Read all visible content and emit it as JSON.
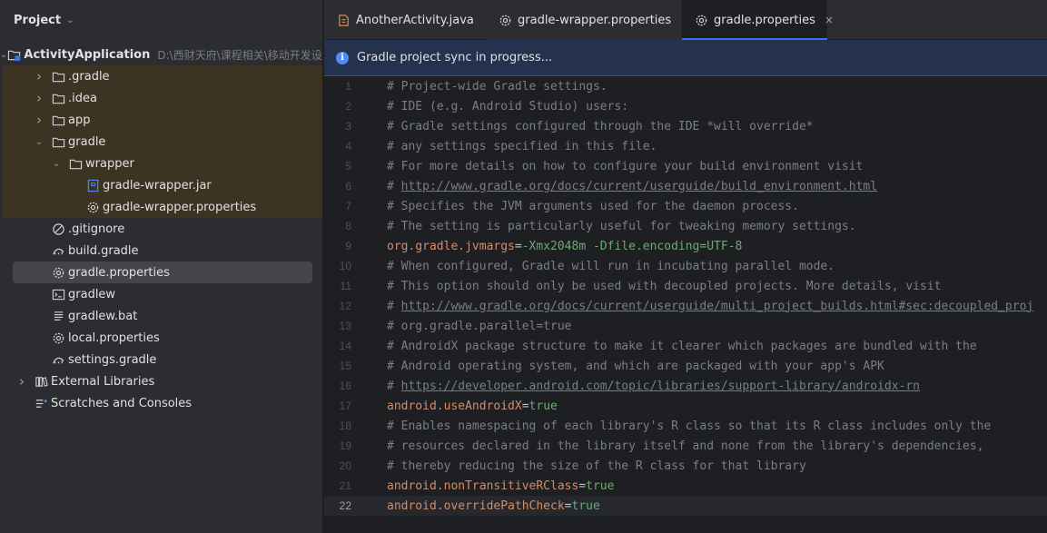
{
  "project_panel": {
    "title": "Project",
    "tree": [
      {
        "label": "ActivityApplication",
        "path": "D:\\西财天府\\课程相关\\移动开发设计",
        "icon": "module-folder-icon",
        "arrow": "down",
        "depth": 0,
        "bold": true
      },
      {
        "label": ".gradle",
        "icon": "folder-icon",
        "arrow": "right",
        "depth": 1,
        "highlight": true
      },
      {
        "label": ".idea",
        "icon": "folder-icon",
        "arrow": "right",
        "depth": 1,
        "highlight": true
      },
      {
        "label": "app",
        "icon": "folder-icon",
        "arrow": "right",
        "depth": 1,
        "highlight": true
      },
      {
        "label": "gradle",
        "icon": "folder-icon",
        "arrow": "down",
        "depth": 1,
        "highlight": true
      },
      {
        "label": "wrapper",
        "icon": "folder-icon",
        "arrow": "down",
        "depth": 2,
        "highlight": true
      },
      {
        "label": "gradle-wrapper.jar",
        "icon": "jar-file-icon",
        "arrow": "",
        "depth": 3,
        "highlight": true
      },
      {
        "label": "gradle-wrapper.properties",
        "icon": "properties-file-icon",
        "arrow": "",
        "depth": 3,
        "highlight": true
      },
      {
        "label": ".gitignore",
        "icon": "gitignore-file-icon",
        "arrow": "",
        "depth": 1
      },
      {
        "label": "build.gradle",
        "icon": "gradle-file-icon",
        "arrow": "",
        "depth": 1
      },
      {
        "label": "gradle.properties",
        "icon": "properties-file-icon",
        "arrow": "",
        "depth": 1,
        "selected": true
      },
      {
        "label": "gradlew",
        "icon": "terminal-file-icon",
        "arrow": "",
        "depth": 1
      },
      {
        "label": "gradlew.bat",
        "icon": "text-file-icon",
        "arrow": "",
        "depth": 1
      },
      {
        "label": "local.properties",
        "icon": "properties-file-icon",
        "arrow": "",
        "depth": 1
      },
      {
        "label": "settings.gradle",
        "icon": "gradle-file-icon",
        "arrow": "",
        "depth": 1
      },
      {
        "label": "External Libraries",
        "icon": "libraries-icon",
        "arrow": "right",
        "depth": 0
      },
      {
        "label": "Scratches and Consoles",
        "icon": "scratches-icon",
        "arrow": "",
        "depth": 0
      }
    ]
  },
  "tabs": [
    {
      "label": "AnotherActivity.java",
      "icon": "java-file-icon",
      "active": false,
      "closable": false
    },
    {
      "label": "gradle-wrapper.properties",
      "icon": "properties-file-icon",
      "active": false,
      "closable": false
    },
    {
      "label": "gradle.properties",
      "icon": "properties-file-icon",
      "active": true,
      "closable": true,
      "close_glyph": "×"
    }
  ],
  "banner": {
    "text": "Gradle project sync in progress...",
    "icon": "info-icon",
    "icon_glyph": "i"
  },
  "editor": {
    "current_line": 22,
    "lines": [
      {
        "n": 1,
        "type": "comment",
        "text": "# Project-wide Gradle settings."
      },
      {
        "n": 2,
        "type": "comment",
        "text": "# IDE (e.g. Android Studio) users:"
      },
      {
        "n": 3,
        "type": "comment",
        "text": "# Gradle settings configured through the IDE *will override*"
      },
      {
        "n": 4,
        "type": "comment",
        "text": "# any settings specified in this file."
      },
      {
        "n": 5,
        "type": "comment",
        "text": "# For more details on how to configure your build environment visit"
      },
      {
        "n": 6,
        "type": "url",
        "prefix": "# ",
        "text": "http://www.gradle.org/docs/current/userguide/build_environment.html"
      },
      {
        "n": 7,
        "type": "comment",
        "text": "# Specifies the JVM arguments used for the daemon process."
      },
      {
        "n": 8,
        "type": "comment",
        "text": "# The setting is particularly useful for tweaking memory settings."
      },
      {
        "n": 9,
        "type": "prop",
        "key": "org.gradle.jvmargs",
        "eq": "=",
        "value": "-Xmx2048m -Dfile.encoding=UTF-8"
      },
      {
        "n": 10,
        "type": "comment",
        "text": "# When configured, Gradle will run in incubating parallel mode."
      },
      {
        "n": 11,
        "type": "comment",
        "text": "# This option should only be used with decoupled projects. More details, visit"
      },
      {
        "n": 12,
        "type": "url",
        "prefix": "# ",
        "text": "http://www.gradle.org/docs/current/userguide/multi_project_builds.html#sec:decoupled_proj"
      },
      {
        "n": 13,
        "type": "comment",
        "text": "# org.gradle.parallel=true"
      },
      {
        "n": 14,
        "type": "comment",
        "text": "# AndroidX package structure to make it clearer which packages are bundled with the"
      },
      {
        "n": 15,
        "type": "comment",
        "text": "# Android operating system, and which are packaged with your app's APK"
      },
      {
        "n": 16,
        "type": "url",
        "prefix": "# ",
        "text": "https://developer.android.com/topic/libraries/support-library/androidx-rn"
      },
      {
        "n": 17,
        "type": "prop",
        "key": "android.useAndroidX",
        "eq": "=",
        "value": "true"
      },
      {
        "n": 18,
        "type": "comment",
        "text": "# Enables namespacing of each library's R class so that its R class includes only the"
      },
      {
        "n": 19,
        "type": "comment",
        "text": "# resources declared in the library itself and none from the library's dependencies,"
      },
      {
        "n": 20,
        "type": "comment",
        "text": "# thereby reducing the size of the R class for that library"
      },
      {
        "n": 21,
        "type": "prop",
        "key": "android.nonTransitiveRClass",
        "eq": "=",
        "value": "true"
      },
      {
        "n": 22,
        "type": "prop",
        "key": "android.overridePathCheck",
        "eq": "=",
        "value": "true"
      }
    ]
  },
  "colors": {
    "comment": "#7a7e85",
    "key": "#cf8e6d",
    "value": "#6aab73",
    "accent": "#3574f0",
    "highlight_bg": "#3d3322",
    "selected_bg": "#43454a"
  }
}
